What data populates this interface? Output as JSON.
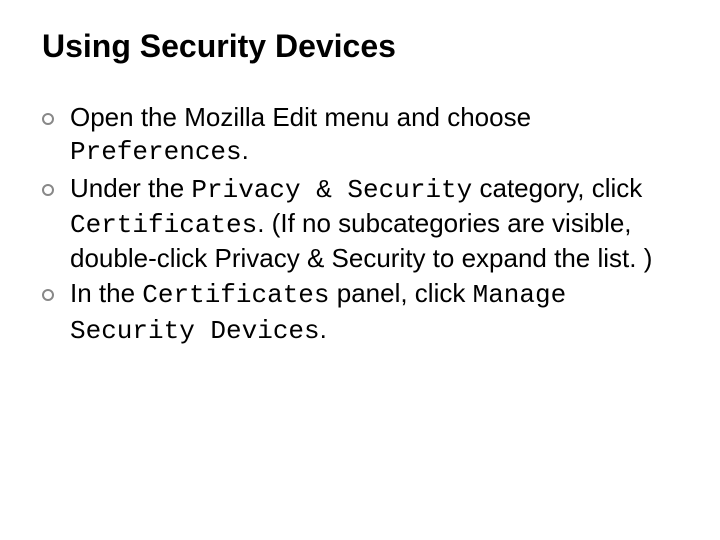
{
  "heading": "Using Security Devices",
  "items": [
    {
      "parts": [
        {
          "text": "Open the Mozilla Edit menu and choose ",
          "mono": false
        },
        {
          "text": "Preferences",
          "mono": true
        },
        {
          "text": ".",
          "mono": false
        }
      ]
    },
    {
      "parts": [
        {
          "text": "Under the ",
          "mono": false
        },
        {
          "text": "Privacy & Security",
          "mono": true
        },
        {
          "text": " category, click ",
          "mono": false
        },
        {
          "text": "Certificates",
          "mono": true
        },
        {
          "text": ". (If no subcategories are visible, double-click Privacy & Security to expand the list. )",
          "mono": false
        }
      ]
    },
    {
      "parts": [
        {
          "text": "In the ",
          "mono": false
        },
        {
          "text": "Certificates",
          "mono": true
        },
        {
          "text": " panel, click ",
          "mono": false
        },
        {
          "text": "Manage Security Devices",
          "mono": true
        },
        {
          "text": ".",
          "mono": false
        }
      ]
    }
  ]
}
